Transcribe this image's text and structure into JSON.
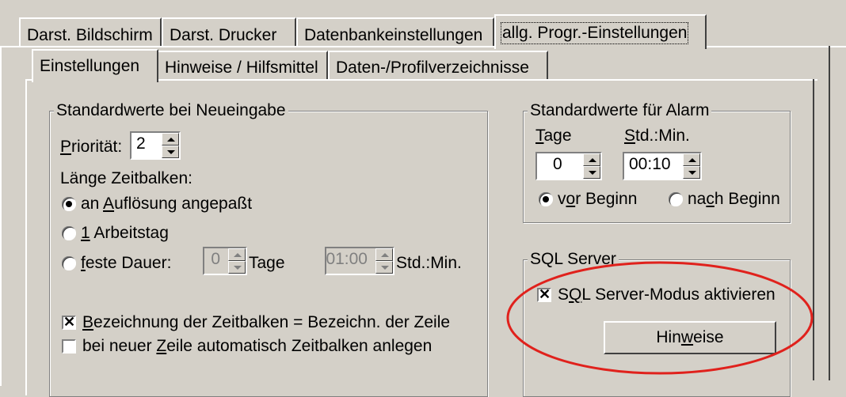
{
  "outer_tabs": [
    {
      "label": "Darst. Bildschirm"
    },
    {
      "label": "Darst. Drucker"
    },
    {
      "label": "Datenbankeinstellungen"
    },
    {
      "label": "allg. Progr.-Einstellungen",
      "active": true
    }
  ],
  "inner_tabs": [
    {
      "label": "Einstellungen",
      "active": true
    },
    {
      "label": "Hinweise / Hilfsmittel"
    },
    {
      "label": "Daten-/Profilverzeichnisse"
    }
  ],
  "defaults_group": {
    "title": "Standardwerte bei Neueingabe",
    "priority_label": "Priorität:",
    "priority_value": "2",
    "bar_length_label": "Länge Zeitbalken:",
    "radio_resolution": "an Auflösung angepaßt",
    "radio_workday": "1 Arbeitstag",
    "radio_fixed": "feste Dauer:",
    "fixed_days_value": "0",
    "days_label": "Tage",
    "fixed_time_value": "01:00",
    "time_label": "Std.:Min.",
    "check_bar_name": "Bezeichnung der Zeitbalken = Bezeichn. der Zeile",
    "check_bar_name_checked": true,
    "check_auto_bar": "bei neuer Zeile automatisch Zeitbalken anlegen",
    "check_auto_bar_checked": false
  },
  "alarm_group": {
    "title": "Standardwerte für Alarm",
    "days_label": "Tage",
    "time_label": "Std.:Min.",
    "days_value": "0",
    "time_value": "00:10",
    "radio_before": "vor Beginn",
    "radio_after": "nach Beginn"
  },
  "sql_group": {
    "title": "SQL Server",
    "check_label": "SQL Server-Modus aktivieren",
    "checked": true,
    "hints_button": "Hinweise"
  },
  "colors": {
    "annotation": "#e0211c",
    "face": "#d4d0c8"
  }
}
